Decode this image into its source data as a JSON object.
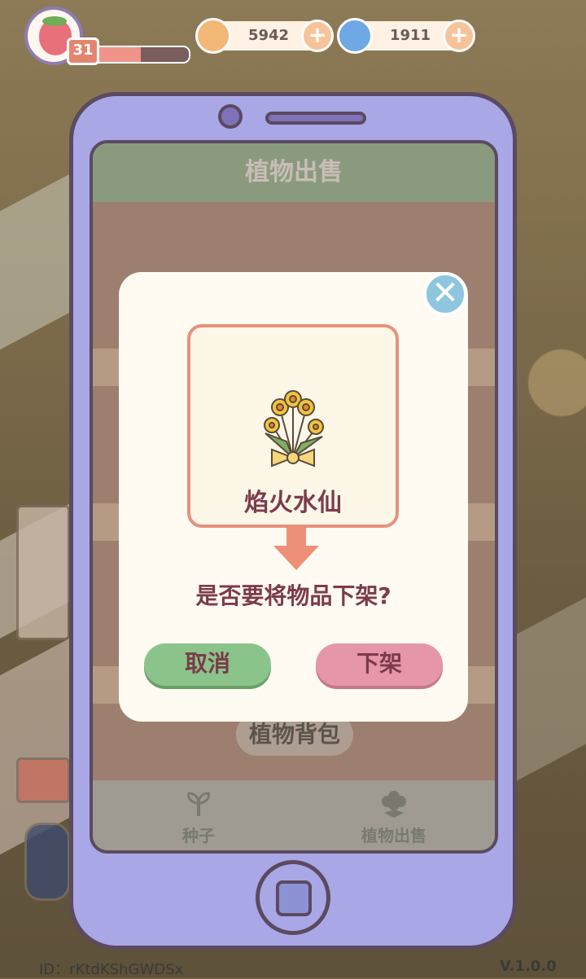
{
  "hud": {
    "level": "31",
    "xp_fraction": 0.5,
    "coins": "5942",
    "gems": "1911",
    "coin_icon": "coin-icon",
    "gem_icon": "swirl-gem-icon",
    "plus_label": "+"
  },
  "phone": {
    "screen_title": "植物出售",
    "backpack_label": "植物背包",
    "tabs": [
      {
        "label": "种子",
        "icon": "sprout-icon"
      },
      {
        "label": "植物出售",
        "icon": "flower-icon"
      }
    ]
  },
  "dialog": {
    "item_name": "焰火水仙",
    "item_icon": "daffodil-bouquet-icon",
    "question": "是否要将物品下架?",
    "cancel_label": "取消",
    "confirm_label": "下架",
    "close_label": "✕"
  },
  "footer": {
    "id_text": "ID：rKtdKShGWDSx",
    "version": "V.1.0.0"
  },
  "colors": {
    "phone": "#a9a7e6",
    "cancel": "#8bc48a",
    "confirm": "#e597a9",
    "card_border": "#e8917c",
    "text": "#7c3b4b"
  }
}
